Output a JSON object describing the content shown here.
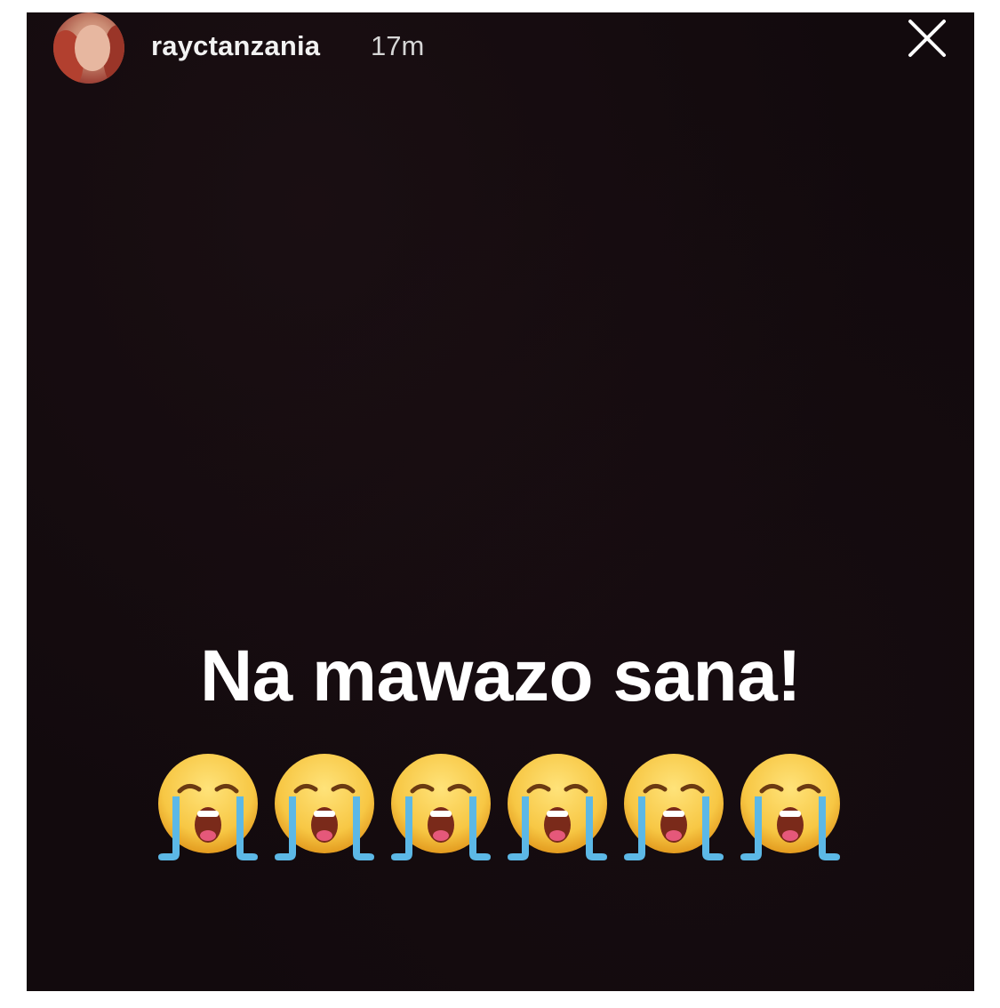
{
  "story": {
    "username": "rayctanzania",
    "time_ago": "17m",
    "close_icon": "close-icon",
    "caption": "Na mawazo sana!",
    "emojis": [
      "loudly-crying-face",
      "loudly-crying-face",
      "loudly-crying-face",
      "loudly-crying-face",
      "loudly-crying-face",
      "loudly-crying-face"
    ]
  },
  "colors": {
    "background": "#120a0d",
    "text": "#ffffff",
    "emoji_face": "#f7c744",
    "emoji_tears": "#5cb8e6"
  }
}
